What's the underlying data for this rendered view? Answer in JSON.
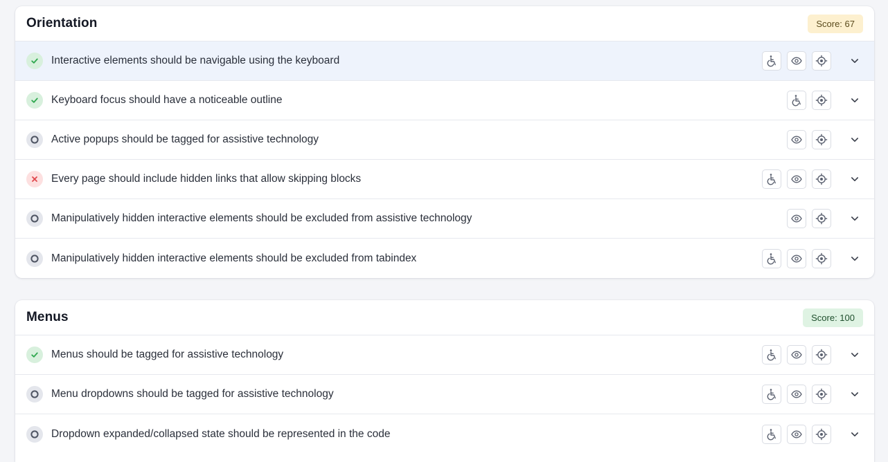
{
  "sections": [
    {
      "title": "Orientation",
      "score": "Score: 67",
      "rows": [
        {
          "label": "Interactive elements should be navigable using the keyboard",
          "status": "pass",
          "actions": [
            "accessibility-icon",
            "eye-icon",
            "target-icon"
          ]
        },
        {
          "label": "Keyboard focus should have a noticeable outline",
          "status": "pass",
          "actions": [
            "accessibility-icon",
            "target-icon"
          ]
        },
        {
          "label": "Active popups should be tagged for assistive technology",
          "status": "neutral",
          "actions": [
            "eye-icon",
            "target-icon"
          ]
        },
        {
          "label": "Every page should include hidden links that allow skipping blocks",
          "status": "fail",
          "actions": [
            "accessibility-icon",
            "eye-icon",
            "target-icon"
          ]
        },
        {
          "label": "Manipulatively hidden interactive elements should be excluded from assistive technology",
          "status": "neutral",
          "actions": [
            "eye-icon",
            "target-icon"
          ]
        },
        {
          "label": "Manipulatively hidden interactive elements should be excluded from tabindex",
          "status": "neutral",
          "actions": [
            "accessibility-icon",
            "eye-icon",
            "target-icon"
          ]
        }
      ]
    },
    {
      "title": "Menus",
      "score": "Score: 100",
      "rows": [
        {
          "label": "Menus should be tagged for assistive technology",
          "status": "pass",
          "actions": [
            "accessibility-icon",
            "eye-icon",
            "target-icon"
          ]
        },
        {
          "label": "Menu dropdowns should be tagged for assistive technology",
          "status": "neutral",
          "actions": [
            "accessibility-icon",
            "eye-icon",
            "target-icon"
          ]
        },
        {
          "label": "Dropdown expanded/collapsed state should be represented in the code",
          "status": "neutral",
          "actions": [
            "accessibility-icon",
            "eye-icon",
            "target-icon"
          ]
        }
      ]
    }
  ],
  "colors": {
    "pass": "#2fa84f",
    "fail": "#e0474c",
    "neutral": "#4f5563",
    "score_warn_bg": "#fdf0cf",
    "score_good_bg": "#dff3e3"
  }
}
